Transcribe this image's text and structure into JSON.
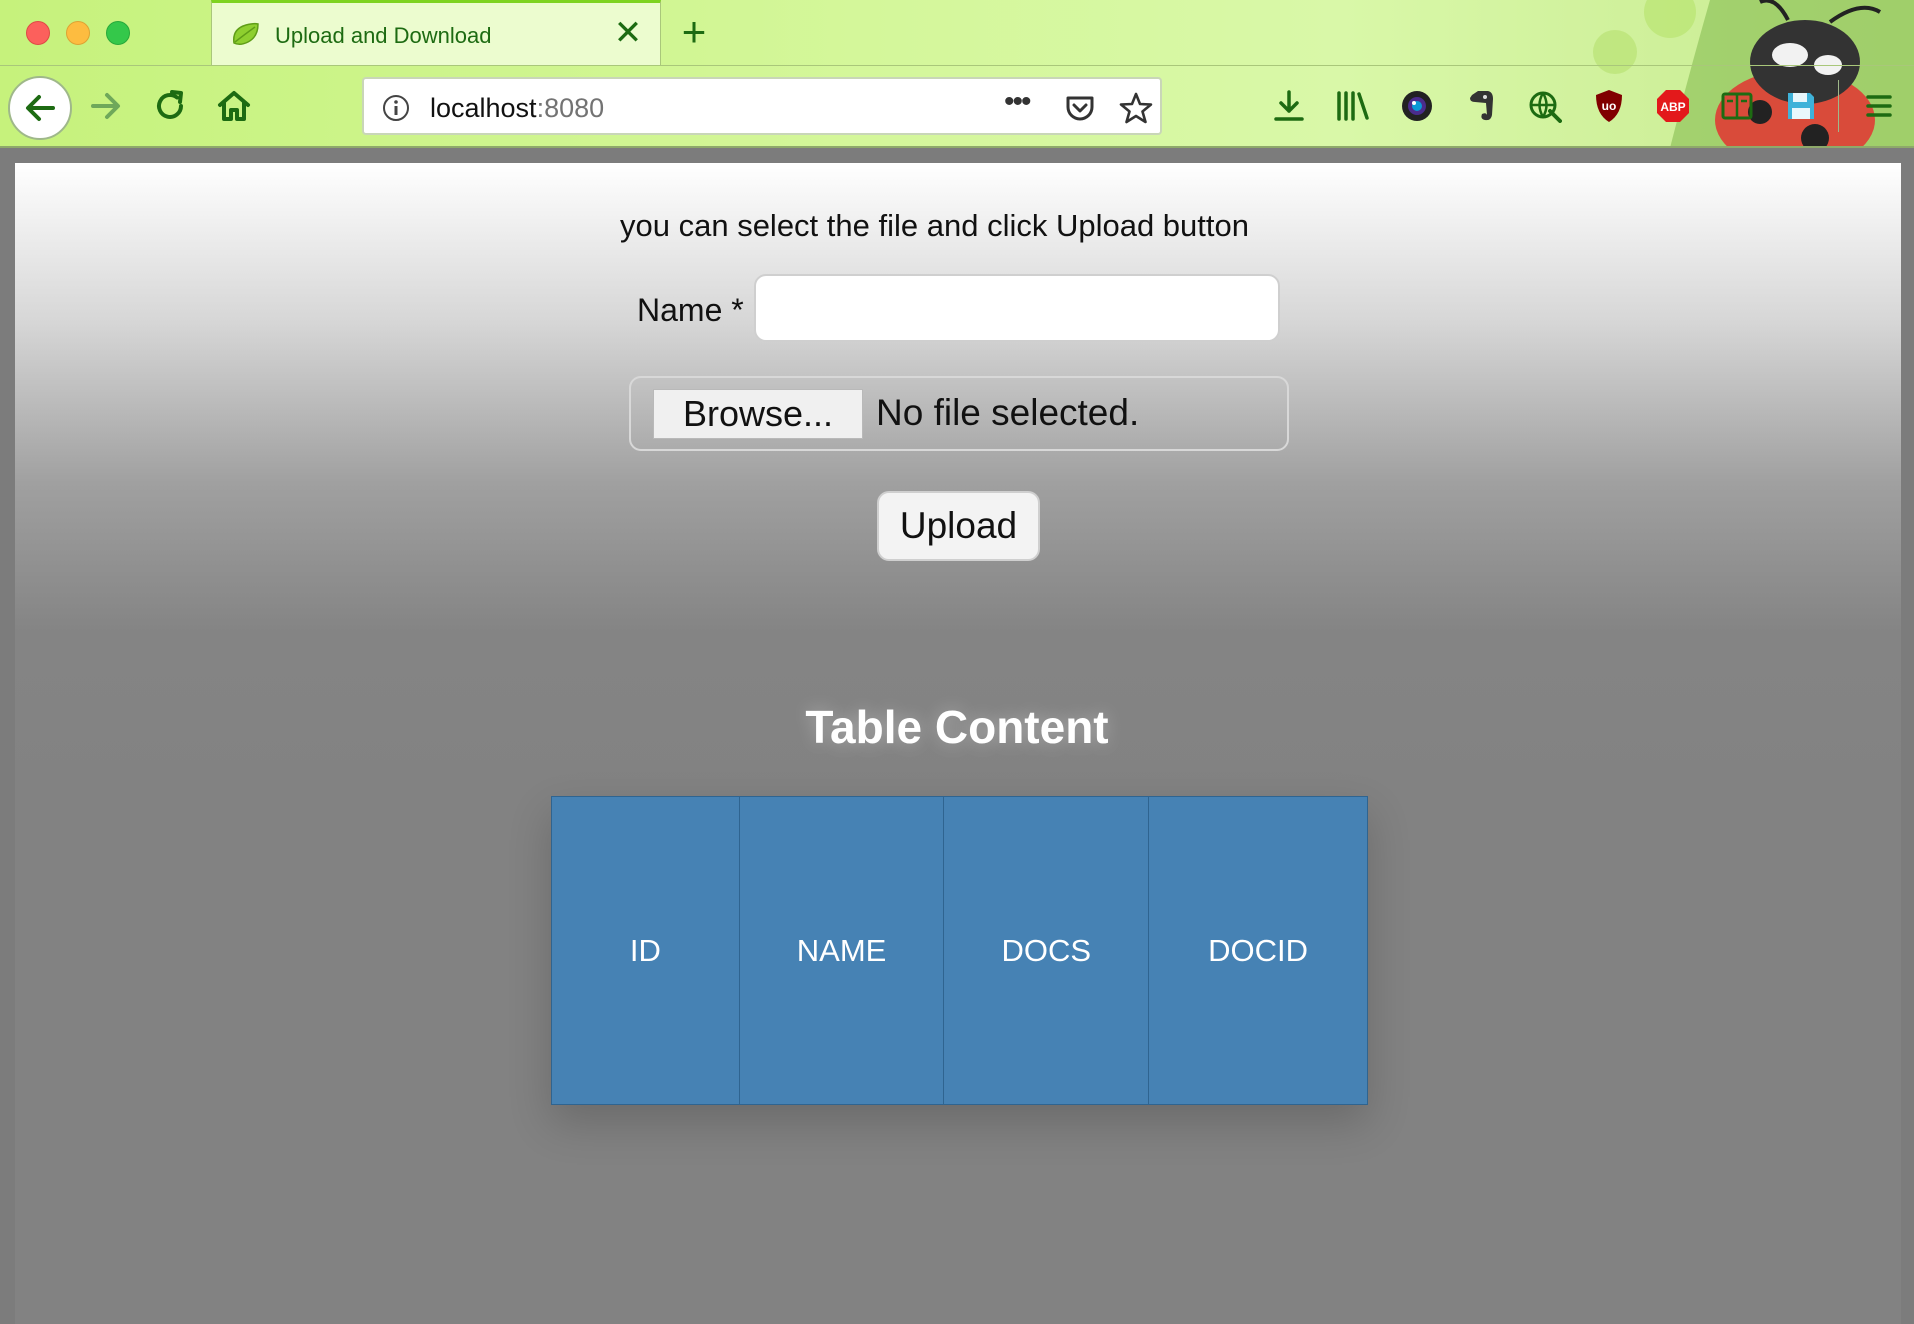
{
  "browser": {
    "tab_title": "Upload and Download",
    "url_host": "localhost",
    "url_port": ":8080"
  },
  "page": {
    "instructions": "you can select the file and click Upload button",
    "name_label": "Name *",
    "name_value": "",
    "browse_label": "Browse...",
    "file_status": "No file selected.",
    "upload_label": "Upload",
    "table_title": "Table Content",
    "table_headers": [
      "ID",
      "NAME",
      "DOCS",
      "DOCID"
    ]
  },
  "colors": {
    "chrome_green": "#c6f27c",
    "accent_green": "#1d6b12",
    "table_header_blue": "#4682b4",
    "page_gray": "#828282"
  },
  "icons": {
    "toolbar": [
      "download-icon",
      "library-icon",
      "camera-extension-icon",
      "evernote-icon",
      "globe-extension-icon",
      "ublock-icon",
      "adblock-plus-icon",
      "reader-view-icon",
      "save-icon",
      "menu-icon"
    ]
  },
  "extensions": {
    "ublock_label": "uo",
    "abp_label": "ABP"
  }
}
